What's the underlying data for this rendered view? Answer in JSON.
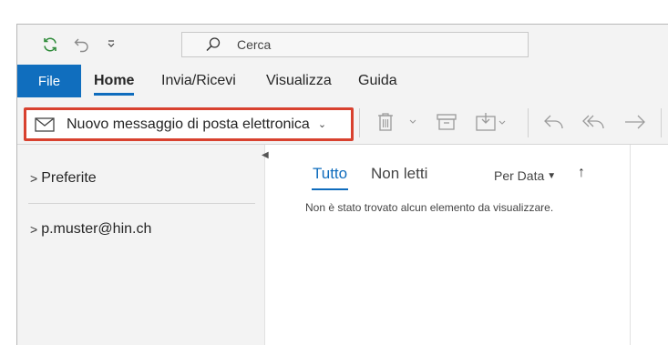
{
  "quick_access": {
    "sync_icon": "sync-icon",
    "undo_icon": "undo-icon",
    "customize_icon": "chevron-down-icon"
  },
  "search": {
    "text": "Cerca",
    "icon": "search-icon"
  },
  "tabs": [
    {
      "label": "File"
    },
    {
      "label": "Home"
    },
    {
      "label": "Invia/Ricevi"
    },
    {
      "label": "Visualizza"
    },
    {
      "label": "Guida"
    }
  ],
  "ribbon": {
    "new_message_label": "Nuovo messaggio di posta elettronica",
    "highlight_color": "#d8412f",
    "icons": [
      "mail-icon",
      "delete-icon",
      "archive-icon",
      "move-icon",
      "reply-icon",
      "reply-all-icon",
      "forward-icon"
    ]
  },
  "folders": {
    "favorites": "Preferite",
    "account": "p.muster@hin.ch"
  },
  "message_list": {
    "filter_all": "Tutto",
    "filter_unread": "Non letti",
    "sort_label": "Per Data",
    "empty_text": "Non è stato trovato alcun elemento da visualizzare."
  },
  "colors": {
    "accent": "#0f6cbd",
    "file_tab": "#106ebe"
  }
}
